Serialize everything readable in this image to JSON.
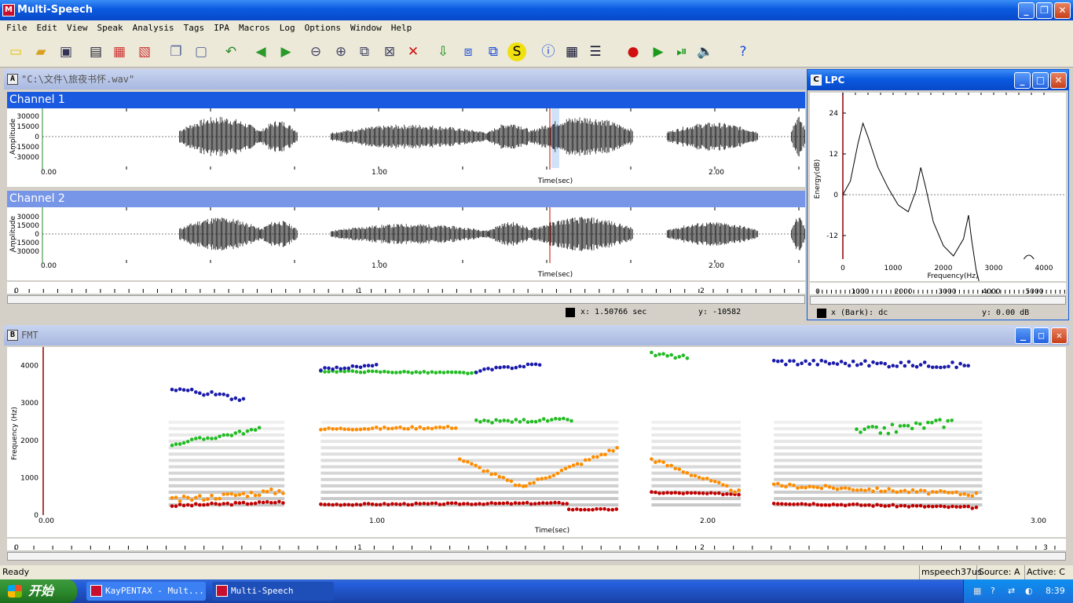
{
  "app": {
    "title": "Multi-Speech"
  },
  "menu": [
    "File",
    "Edit",
    "View",
    "Speak",
    "Analysis",
    "Tags",
    "IPA",
    "Macros",
    "Log",
    "Options",
    "Window",
    "Help"
  ],
  "toolbar": {
    "icons": [
      "new-file-icon",
      "open-folder-icon",
      "save-icon",
      "print-icon",
      "print-preview-icon",
      "export-icon",
      "copy-icon",
      "paste-icon",
      "undo-icon",
      "back-icon",
      "forward-icon",
      "zoom-out-icon",
      "zoom-in-icon",
      "zoom-selection-icon",
      "zoom-clear-icon",
      "delete-icon",
      "download-icon",
      "compare-icon",
      "window-icon",
      "s-icon",
      "info-icon",
      "table-icon",
      "list-icon",
      "record-icon",
      "play-icon",
      "play-selection-icon",
      "speaker-icon",
      "help-icon"
    ]
  },
  "windowA": {
    "label": "A",
    "title": "\"C:\\文件\\旅夜书怀.wav\"",
    "channel1": "Channel 1",
    "channel2": "Channel 2",
    "ylabel": "Amplitude",
    "xlabel": "Time(sec)",
    "yticks": [
      "30000",
      "15000",
      "0",
      "-15000",
      "-30000"
    ],
    "xticks": [
      "0.00",
      "1.00",
      "2.00"
    ],
    "ruler_ticks": [
      "0",
      "1",
      "2"
    ],
    "coord_x": "x:  1.50766 sec",
    "coord_y": "y:  -10582"
  },
  "windowC": {
    "label": "C",
    "title": "LPC",
    "ylabel": "Energy(dB)",
    "xlabel": "Frequency(Hz)",
    "yticks": [
      "24",
      "12",
      "0",
      "-12"
    ],
    "xticks": [
      "0",
      "1000",
      "2000",
      "3000",
      "4000"
    ],
    "ruler_ticks": [
      "0",
      "1000",
      "2000",
      "3000",
      "4000",
      "5000"
    ],
    "coord_x": "x  (Bark):  dc",
    "coord_y": "y:  0.00  dB"
  },
  "windowB": {
    "label": "B",
    "title": "FMT",
    "ylabel": "Frequency (Hz)",
    "xlabel": "Time(sec)",
    "yticks": [
      "4000",
      "3000",
      "2000",
      "1000",
      "0"
    ],
    "xticks": [
      "0.00",
      "1.00",
      "2.00",
      "3.00"
    ],
    "ruler_ticks": [
      "0",
      "1",
      "2",
      "3"
    ]
  },
  "status": {
    "ready": "Ready",
    "module": "mspeech37us",
    "source": "Source:  A",
    "active": "Active:  C"
  },
  "taskbar": {
    "start": "开始",
    "task1": "KayPENTAX - Mult...",
    "task2": "Multi-Speech",
    "clock": "8:39"
  },
  "colors": {
    "f1": "#c00000",
    "f2": "#ff8c00",
    "f3": "#22bb22",
    "f4": "#1a1aaa"
  }
}
